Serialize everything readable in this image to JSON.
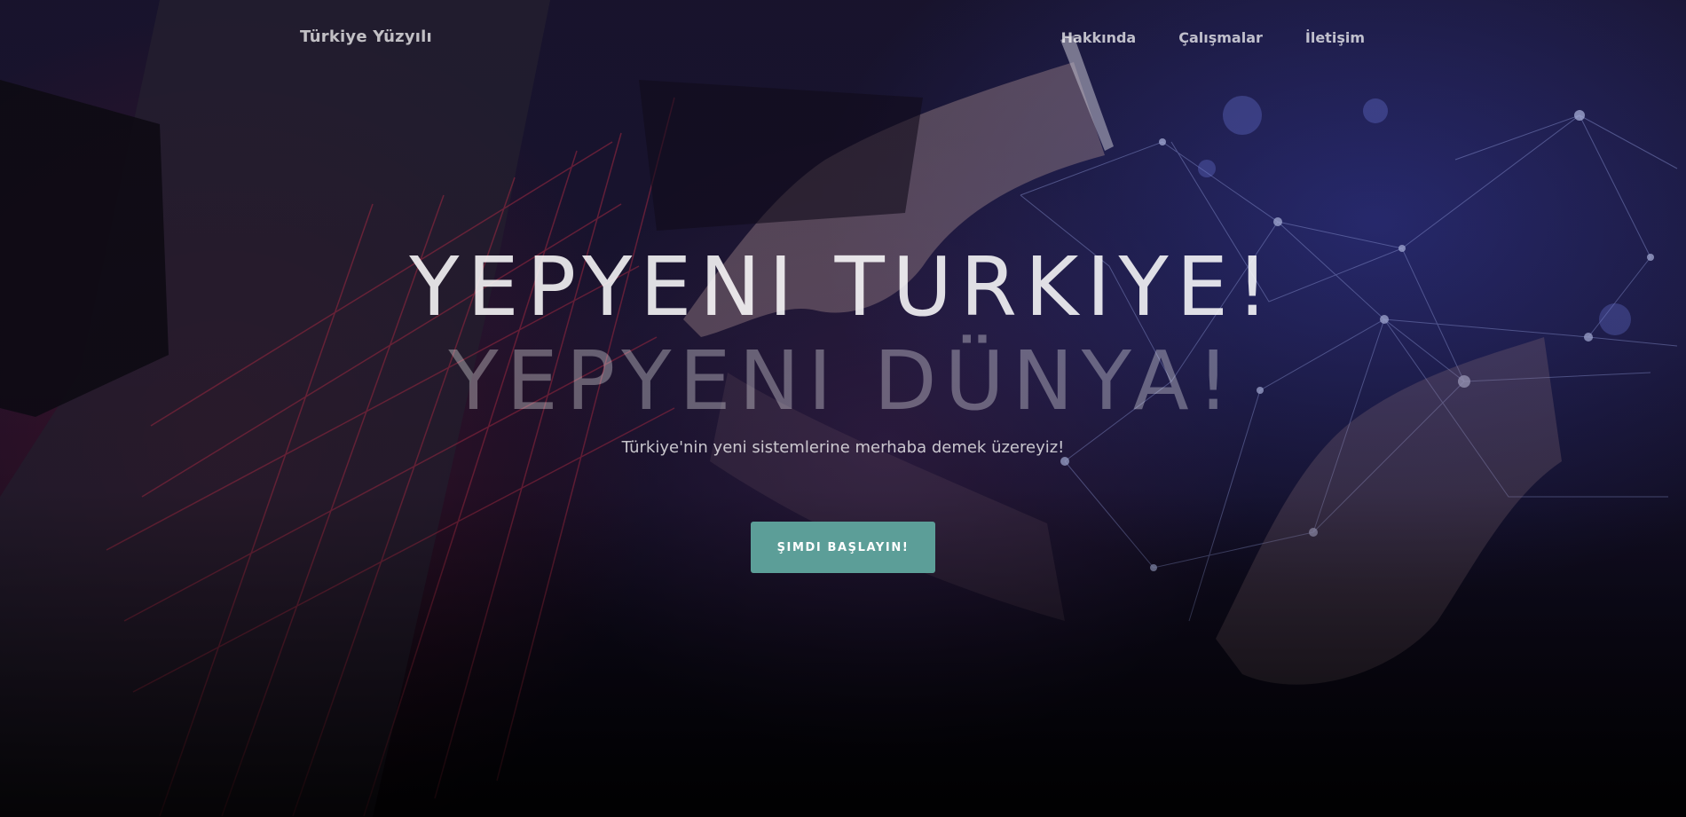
{
  "nav": {
    "brand": "Türkiye Yüzyılı",
    "links": [
      "Hakkında",
      "Çalışmalar",
      "İletişim"
    ]
  },
  "hero": {
    "headline_primary": "YEPYENI TURKIYE!",
    "headline_secondary": "YEPYENI DÜNYA!",
    "subtitle": "Türkiye'nin yeni sistemlerine merhaba demek üzereyiz!",
    "cta_label": "ŞIMDI BAŞLAYIN!"
  },
  "colors": {
    "accent": "#5c9e98",
    "background": "#1b1633",
    "nav_text": "#bdbac6"
  }
}
